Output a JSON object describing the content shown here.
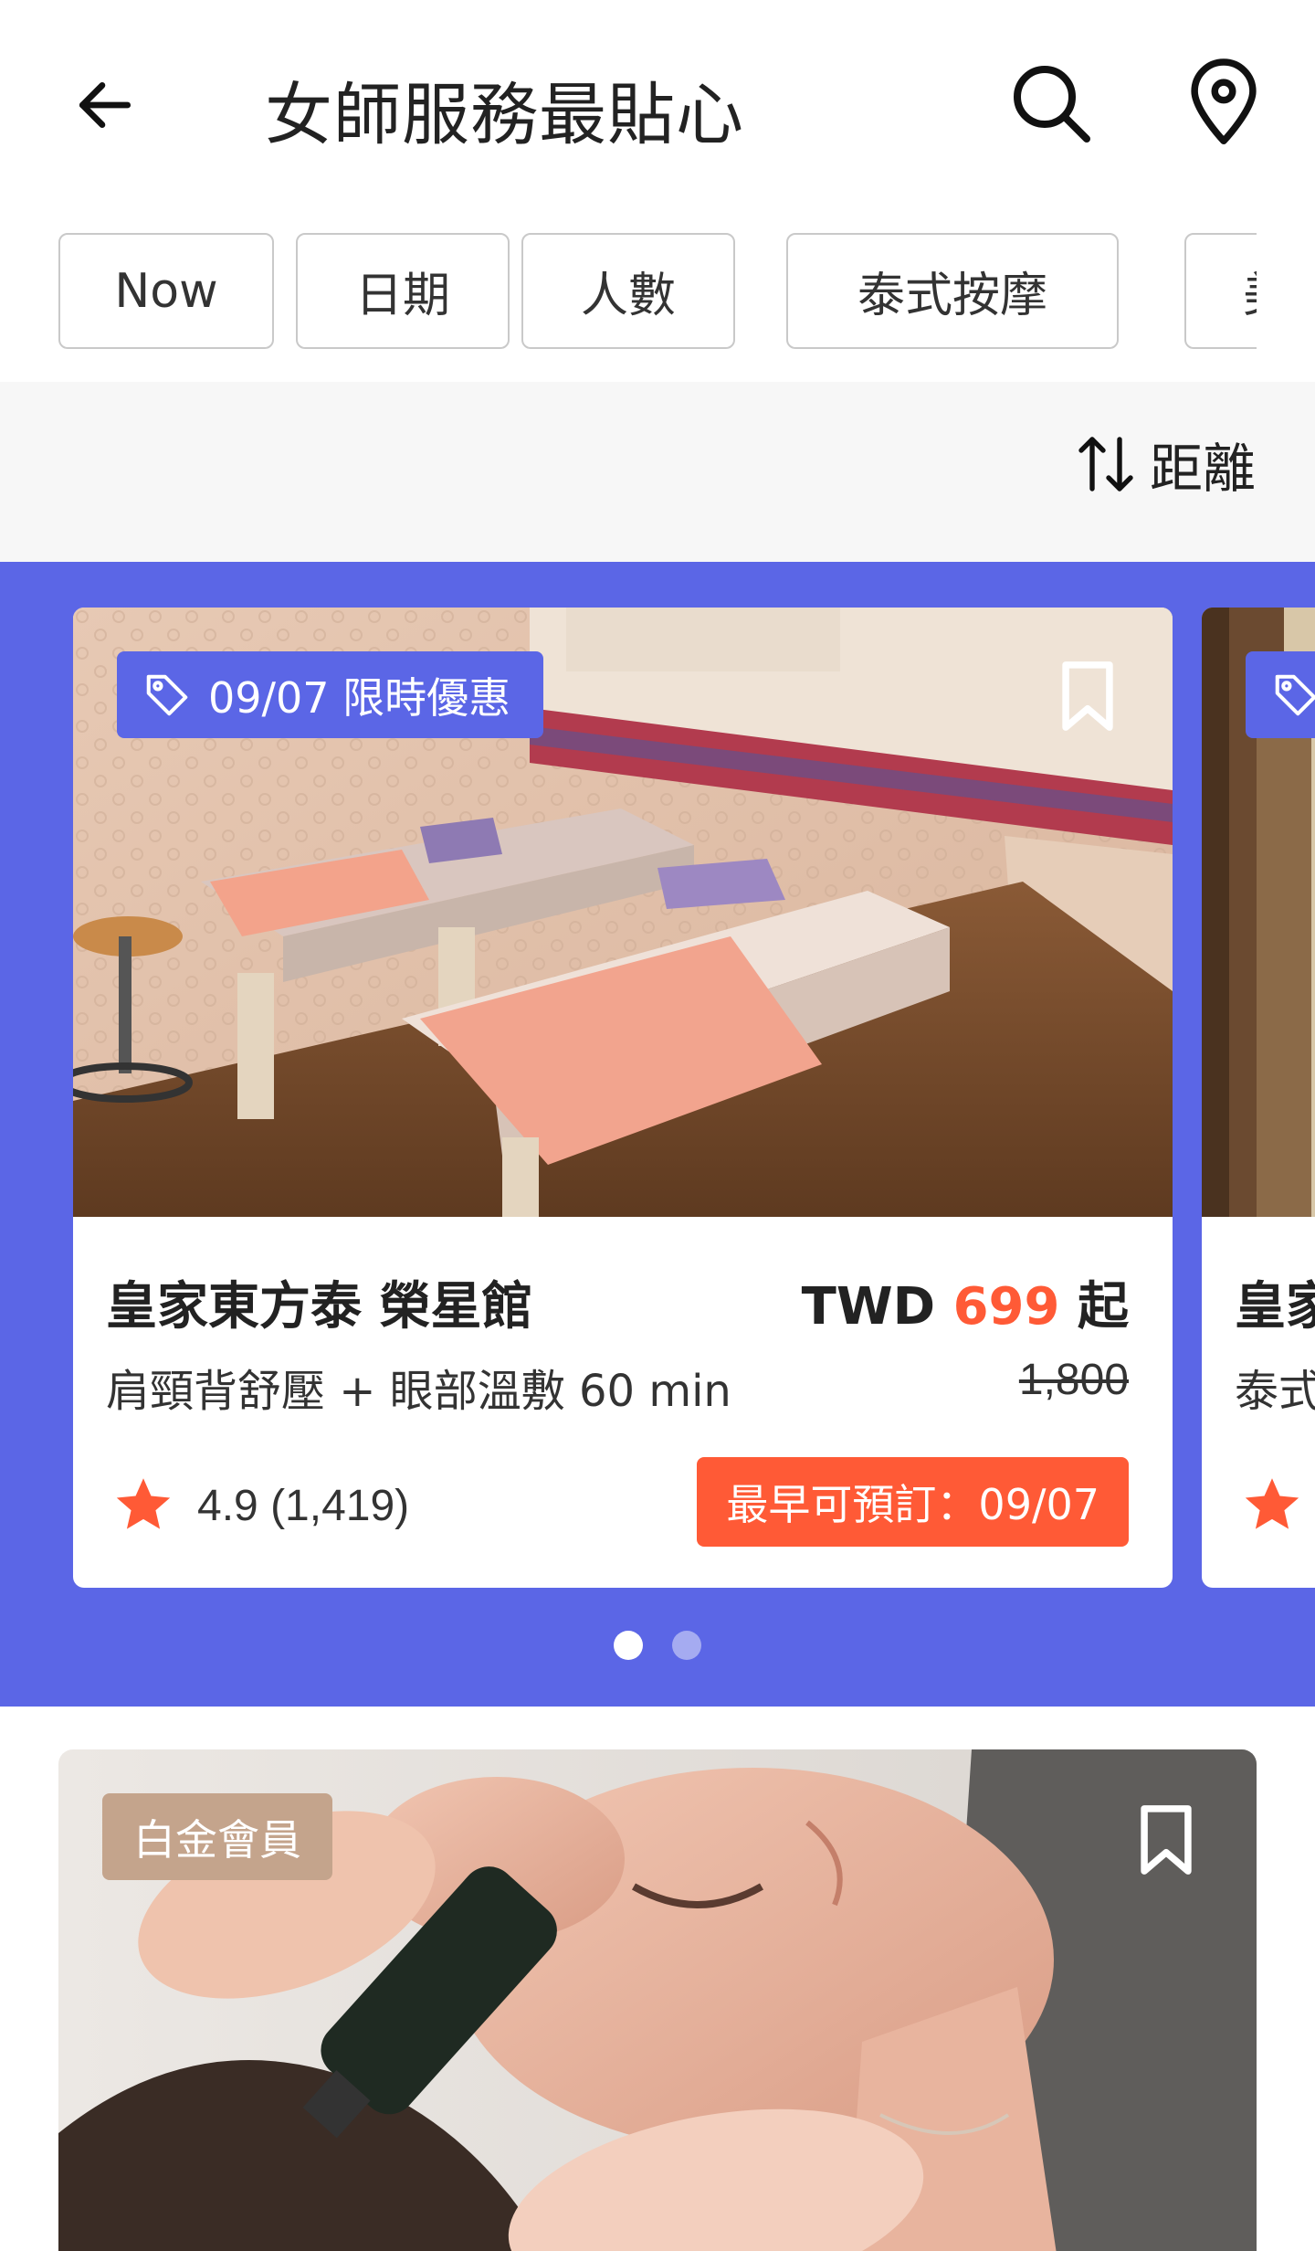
{
  "header": {
    "title": "女師服務最貼心",
    "back_icon": "arrow-left-icon",
    "search_icon": "search-icon",
    "location_icon": "map-pin-icon"
  },
  "filters": [
    "Now",
    "日期",
    "人數",
    "泰式按摩",
    "美"
  ],
  "sort": {
    "label": "距離",
    "icon": "sort-arrows-icon"
  },
  "featured": {
    "background": "#5b66e6",
    "cards": [
      {
        "promo": "09/07 限時優惠",
        "name": "皇家東方泰 榮星館",
        "currency": "TWD",
        "price": "699",
        "price_suffix": "起",
        "service": "肩頸背舒壓 + 眼部溫敷 60 min",
        "original_price": "1,800",
        "rating": "4.9 (1,419)",
        "booking": "最早可預訂：09/07"
      },
      {
        "name_partial": "皇家",
        "service_partial": "泰式"
      }
    ],
    "active_page": 1,
    "page_count": 2
  },
  "listing": {
    "badge": "白金會員"
  },
  "colors": {
    "accent": "#5b66e6",
    "price": "#ff5a36",
    "member": "#c4a48c"
  }
}
